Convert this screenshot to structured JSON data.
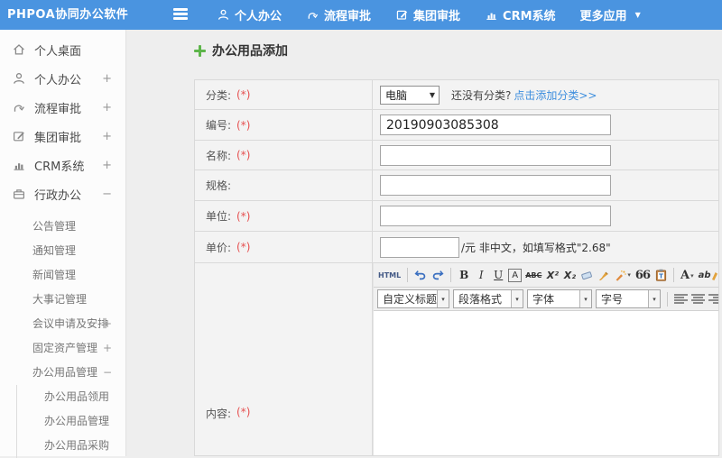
{
  "icons": {
    "caret_down": "▼",
    "caret_small": "▾",
    "link_glyph": "∞"
  },
  "colors": {
    "topbar_blue": "#4a94e0",
    "link_blue": "#3e8ede",
    "required_red": "#e65151",
    "plus_green": "#5db54a"
  },
  "topbar": {
    "logo": "PHPOA协同办公软件",
    "nav": [
      {
        "label": "个人办公"
      },
      {
        "label": "流程审批"
      },
      {
        "label": "集团审批"
      },
      {
        "label": "CRM系统"
      },
      {
        "label": "更多应用"
      }
    ]
  },
  "sidebar": {
    "items": [
      {
        "label": "个人桌面",
        "expand": ""
      },
      {
        "label": "个人办公",
        "expand": "+"
      },
      {
        "label": "流程审批",
        "expand": "+"
      },
      {
        "label": "集团审批",
        "expand": "+"
      },
      {
        "label": "CRM系统",
        "expand": "+"
      },
      {
        "label": "行政办公",
        "expand": "−"
      }
    ],
    "submenu": [
      {
        "label": "公告管理",
        "expand": ""
      },
      {
        "label": "通知管理",
        "expand": ""
      },
      {
        "label": "新闻管理",
        "expand": ""
      },
      {
        "label": "大事记管理",
        "expand": ""
      },
      {
        "label": "会议申请及安排",
        "expand": "+"
      },
      {
        "label": "固定资产管理",
        "expand": "+"
      },
      {
        "label": "办公用品管理",
        "expand": "−"
      }
    ],
    "nested": [
      {
        "label": "办公用品领用"
      },
      {
        "label": "办公用品管理"
      },
      {
        "label": "办公用品采购"
      }
    ]
  },
  "form": {
    "title": "办公用品添加",
    "category": {
      "label": "分类:",
      "required": "(*)",
      "value": "电脑",
      "hint": "还没有分类?",
      "link": "点击添加分类>>"
    },
    "code": {
      "label": "编号:",
      "required": "(*)",
      "value": "20190903085308"
    },
    "name": {
      "label": "名称:",
      "required": "(*)"
    },
    "spec": {
      "label": "规格:",
      "required": ""
    },
    "unit": {
      "label": "单位:",
      "required": "(*)"
    },
    "price": {
      "label": "单价:",
      "required": "(*)",
      "value": "",
      "hint": "/元 非中文，如填写格式\"2.68\""
    },
    "content": {
      "label": "内容:",
      "required": "(*)"
    }
  },
  "editor": {
    "buttons": {
      "html": "HTML",
      "bold": "B",
      "italic": "I",
      "underline": "U",
      "font_a": "A",
      "strike": "ABC",
      "sup": "X²",
      "sub": "X₂",
      "quote": "66",
      "color": "A",
      "highlight": "ab"
    },
    "dropdowns": [
      {
        "label": "自定义标题"
      },
      {
        "label": "段落格式"
      },
      {
        "label": "字体"
      },
      {
        "label": "字号"
      }
    ]
  }
}
